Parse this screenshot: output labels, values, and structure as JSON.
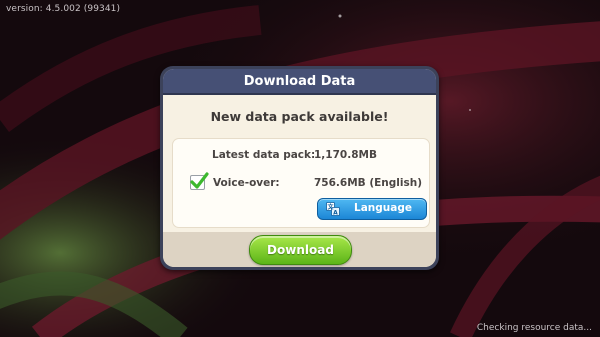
{
  "version": "version: 4.5.002 (99341)",
  "status": "Checking resource data...",
  "dialog": {
    "title": "Download Data",
    "headline": "New data pack available!",
    "latest_label": "Latest data pack:",
    "latest_value": "1,170.8MB",
    "voice_label": "Voice-over:",
    "voice_value": "756.6MB (English)",
    "voice_checked": true,
    "language_button": "Language",
    "download_button": "Download"
  },
  "icons": {
    "checkbox": "checkmark-icon",
    "language": "translate-icon"
  },
  "colors": {
    "title_bar": "#465075",
    "language_button": "#2a97e0",
    "download_button": "#7fcc2c"
  }
}
